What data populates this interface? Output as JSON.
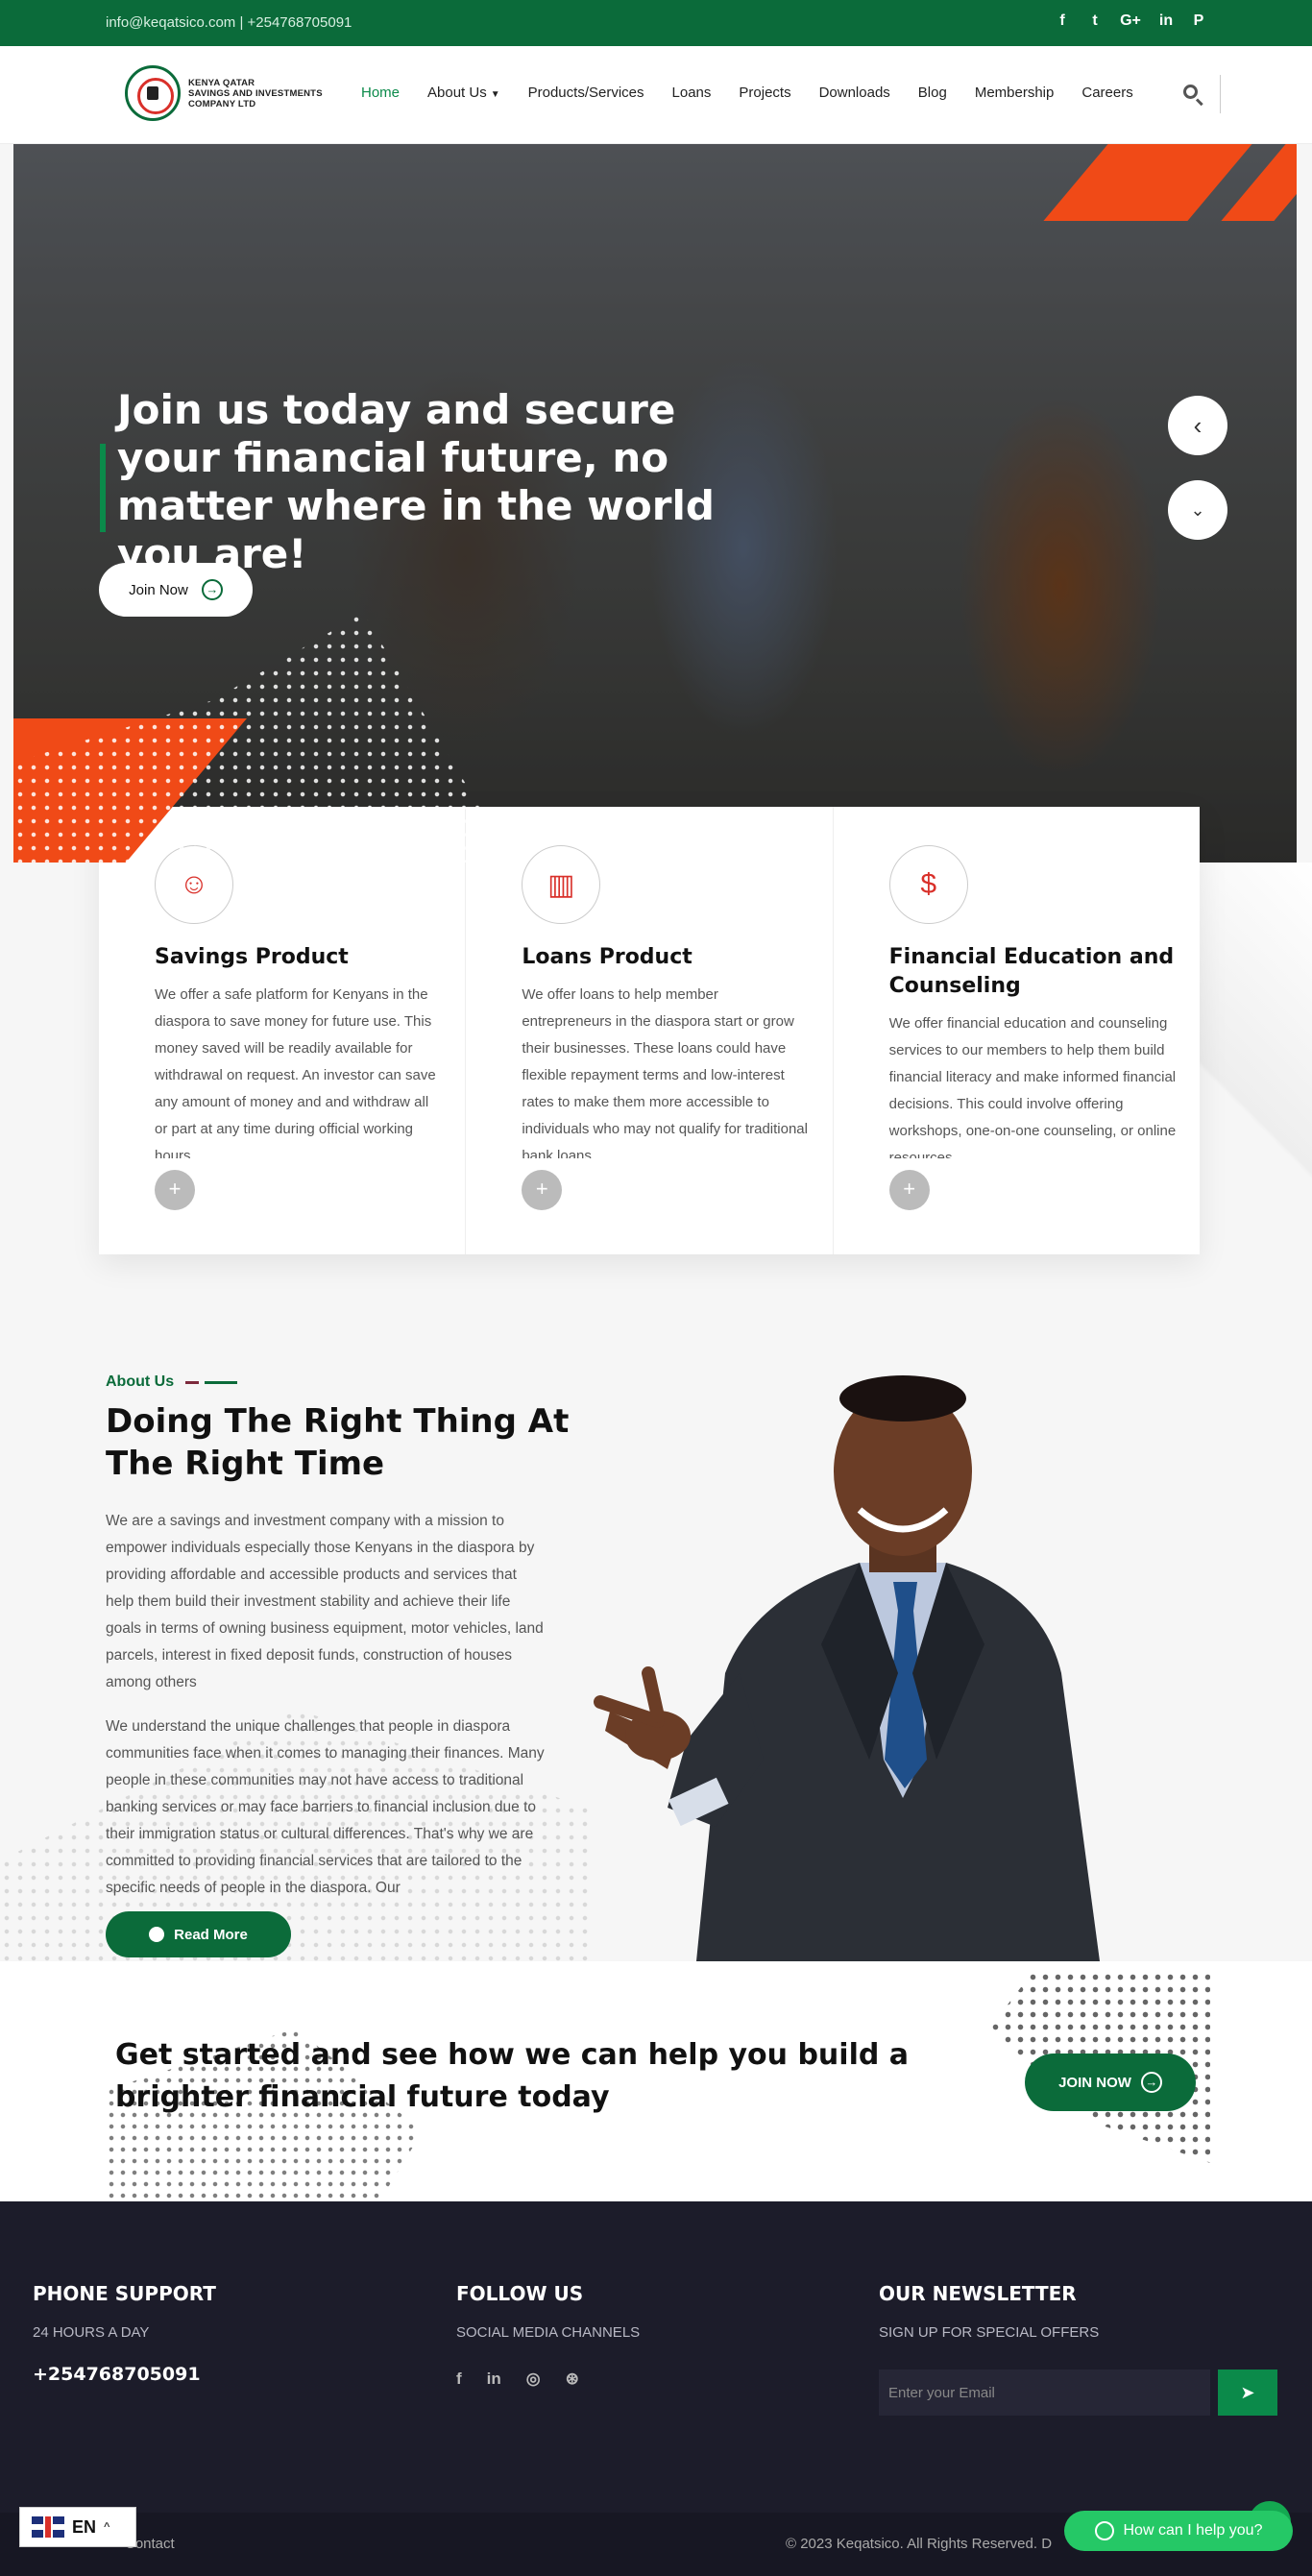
{
  "topbar": {
    "contact": "info@keqatsico.com | +254768705091",
    "social": [
      "f",
      "t",
      "G+",
      "in",
      "P"
    ]
  },
  "logo": {
    "line1": "KENYA QATAR",
    "line2": "SAVINGS AND INVESTMENTS",
    "line3": "COMPANY LTD"
  },
  "nav": {
    "items": [
      "Home",
      "About Us",
      "Products/Services",
      "Loans",
      "Projects",
      "Downloads",
      "Blog",
      "Membership",
      "Careers"
    ],
    "active": "Home"
  },
  "hero": {
    "title": "Join us today and secure your financial future, no matter where in the world you are!",
    "button": "Join Now",
    "arrow_prev": "‹",
    "arrow_next": "⌄"
  },
  "cards": [
    {
      "title": "Savings Product",
      "text": "We offer a safe platform for Kenyans in the diaspora to save money for future use. This money saved will be readily available for withdrawal on request. An investor can save any amount of money and and withdraw all or part at any time during official working hours.",
      "icon": "savings-people-icon"
    },
    {
      "title": "Loans Product",
      "text": "We offer loans to help member entrepreneurs in the diaspora start or grow their businesses. These loans could have flexible repayment terms and low-interest rates to make them more accessible to individuals who may not qualify for traditional bank loans.",
      "icon": "growth-chart-icon"
    },
    {
      "title": "Financial Education and Counseling",
      "text": "We offer financial education and counseling services to our members to help them build financial literacy and make informed financial decisions. This could involve offering workshops, one-on-one counseling, or online resources.",
      "icon": "money-hand-icon"
    }
  ],
  "about": {
    "tag": "About Us",
    "title": "Doing The Right Thing At The Right Time",
    "para1": "We are a savings and investment company with a mission to empower individuals especially those Kenyans in the diaspora by providing affordable and accessible products and services that help them build their investment stability and achieve their life goals in terms of owning business equipment, motor vehicles, land parcels, interest in fixed deposit funds, construction of houses among others",
    "para2": "We understand the unique challenges that people in diaspora communities face when it comes to managing their finances. Many people in these communities may not have access to traditional banking services or may face barriers to financial inclusion due to their immigration status or cultural differences. That's why we are committed to providing financial services that are tailored to the specific needs of people in the diaspora. Our",
    "button": "Read More"
  },
  "cta": {
    "title": "Get started and see how we can help you build a brighter financial future today",
    "button": "JOIN NOW"
  },
  "footer": {
    "phone_title": "PHONE SUPPORT",
    "phone_sub": "24 HOURS A DAY",
    "phone": "+254768705091",
    "follow_title": "FOLLOW US",
    "follow_sub": "SOCIAL MEDIA CHANNELS",
    "follow_icons": [
      "f",
      "in",
      "◎",
      "⊛"
    ],
    "news_title": "OUR NEWSLETTER",
    "news_sub": "SIGN UP FOR SPECIAL OFFERS",
    "email_placeholder": "Enter your Email",
    "contact_link": "Contact",
    "copyright": "© 2023 Keqatsico. All Rights Reserved. D"
  },
  "lang": {
    "code": "EN"
  },
  "chat": {
    "label": "How can I help you?"
  },
  "colors": {
    "brand_green": "#0b6b3a",
    "accent_orange": "#f04a17",
    "footer_bg": "#1c1c2a",
    "whatsapp": "#25c866"
  }
}
